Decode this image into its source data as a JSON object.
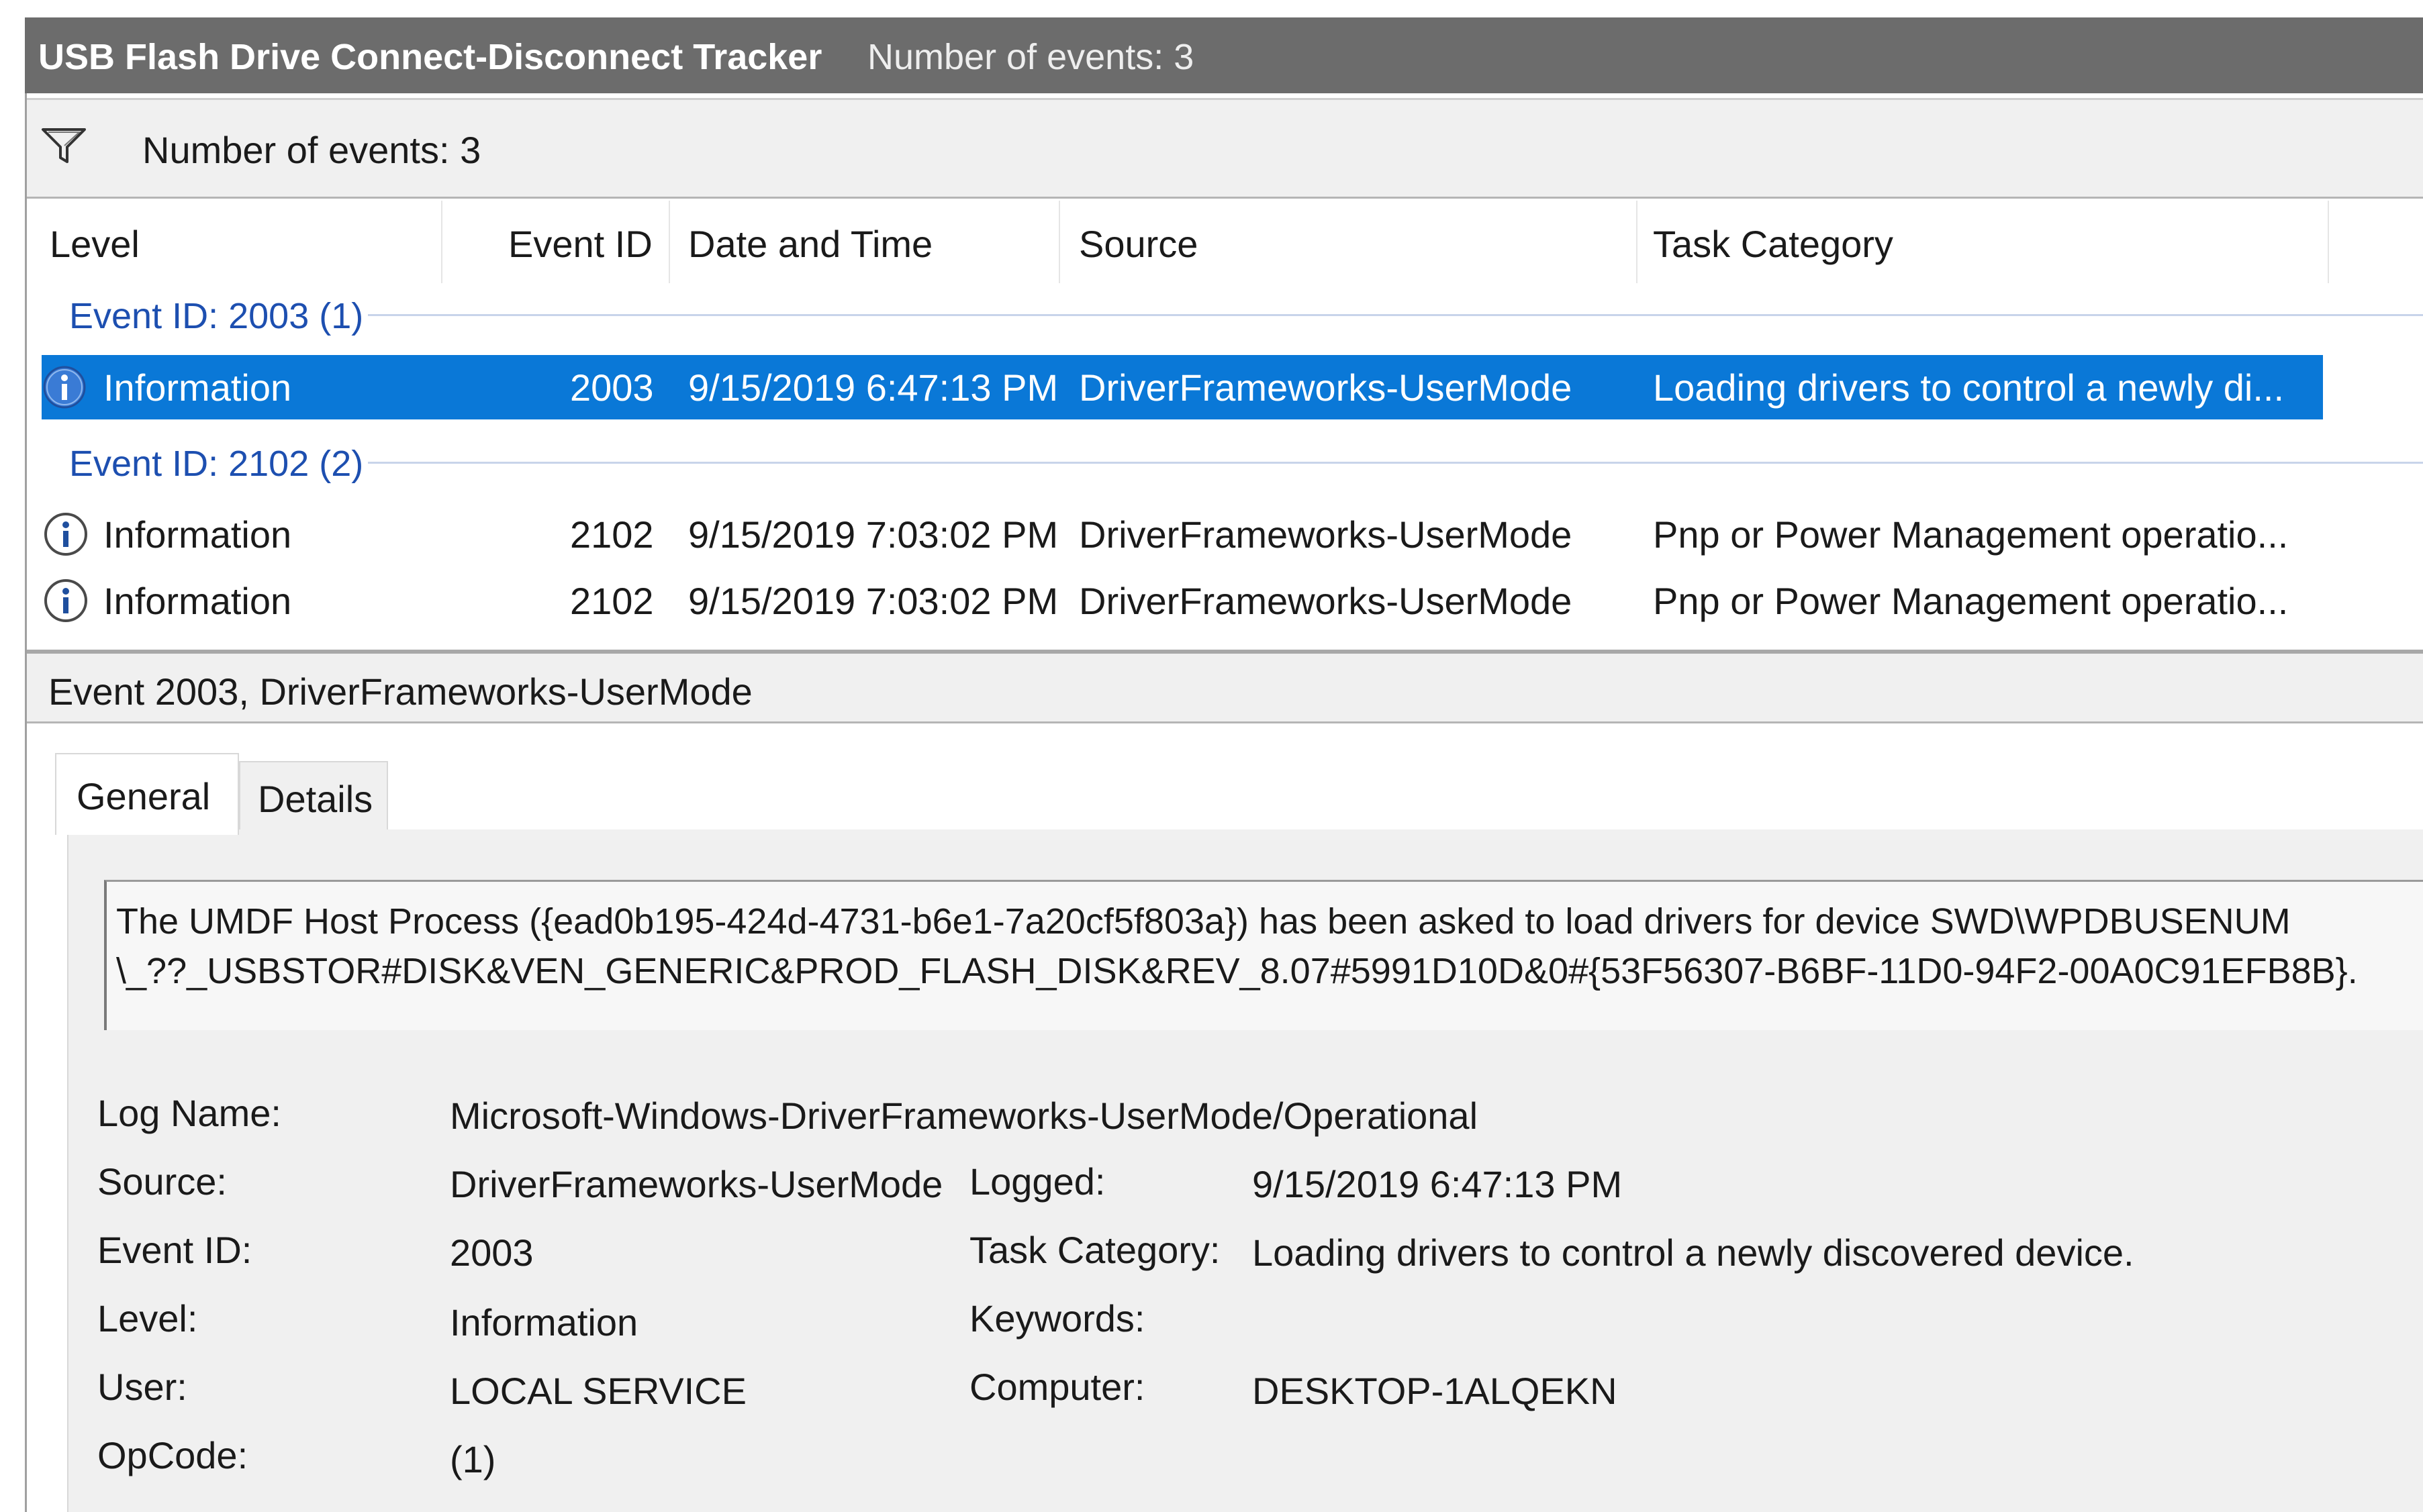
{
  "window": {
    "title": "USB Flash Drive Connect-Disconnect Tracker",
    "subtitle": "Number of events: 3"
  },
  "filter_bar": {
    "text": "Number of events: 3",
    "icon": "filter-icon"
  },
  "columns": [
    "Level",
    "Event ID",
    "Date and Time",
    "Source",
    "Task Category"
  ],
  "groups": [
    {
      "label": "Event ID: 2003 (1)",
      "rows": [
        {
          "level": "Information",
          "event_id": "2003",
          "datetime": "9/15/2019 6:47:13 PM",
          "source": "DriverFrameworks-UserMode",
          "category": "Loading drivers to control a newly di...",
          "selected": true
        }
      ]
    },
    {
      "label": "Event ID: 2102 (2)",
      "rows": [
        {
          "level": "Information",
          "event_id": "2102",
          "datetime": "9/15/2019 7:03:02 PM",
          "source": "DriverFrameworks-UserMode",
          "category": "Pnp or Power Management operatio...",
          "selected": false
        },
        {
          "level": "Information",
          "event_id": "2102",
          "datetime": "9/15/2019 7:03:02 PM",
          "source": "DriverFrameworks-UserMode",
          "category": "Pnp or Power Management operatio...",
          "selected": false
        }
      ]
    }
  ],
  "detail": {
    "header": "Event 2003, DriverFrameworks-UserMode",
    "tabs": [
      "General",
      "Details"
    ],
    "active_tab": "General",
    "message_line1": "The UMDF Host Process ({ead0b195-424d-4731-b6e1-7a20cf5f803a}) has been asked to load drivers for device SWD\\WPDBUSENUM",
    "message_line2": "\\_??_USBSTOR#DISK&VEN_GENERIC&PROD_FLASH_DISK&REV_8.07#5991D10D&0#{53F56307-B6BF-11D0-94F2-00A0C91EFB8B}.",
    "fields": {
      "log_name_label": "Log Name:",
      "log_name": "Microsoft-Windows-DriverFrameworks-UserMode/Operational",
      "source_label": "Source:",
      "source": "DriverFrameworks-UserMode",
      "logged_label": "Logged:",
      "logged": "9/15/2019 6:47:13 PM",
      "event_id_label": "Event ID:",
      "event_id": "2003",
      "task_category_label": "Task Category:",
      "task_category": "Loading drivers to control a newly discovered device.",
      "level_label": "Level:",
      "level": "Information",
      "keywords_label": "Keywords:",
      "keywords": "",
      "user_label": "User:",
      "user": "LOCAL SERVICE",
      "computer_label": "Computer:",
      "computer": "DESKTOP-1ALQEKN",
      "opcode_label": "OpCode:",
      "opcode": "(1)"
    }
  },
  "colors": {
    "titlebar": "#6c6c6c",
    "selection": "#0a78d7",
    "group_text": "#1d4fb0",
    "info_icon": "#3a7bd5"
  }
}
